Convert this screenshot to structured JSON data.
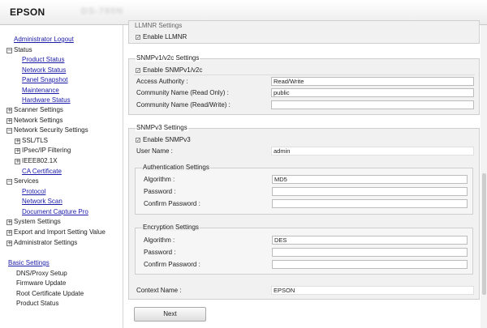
{
  "header": {
    "brand": "EPSON",
    "model": "DS-780N"
  },
  "sidebar": {
    "admin_logout": "Administrator Logout",
    "status": "Status",
    "product_status": "Product Status",
    "network_status": "Network Status",
    "panel_snapshot": "Panel Snapshot",
    "maintenance": "Maintenance",
    "hardware_status": "Hardware Status",
    "scanner_settings": "Scanner Settings",
    "network_settings": "Network Settings",
    "network_security_settings": "Network Security Settings",
    "ssl_tls": "SSL/TLS",
    "ipsec_ip_filtering": "IPsec/IP Filtering",
    "ieee8021x": "IEEE802.1X",
    "ca_certificate": "CA Certificate",
    "services": "Services",
    "protocol": "Protocol",
    "network_scan": "Network Scan",
    "document_capture_pro": "Document Capture Pro",
    "system_settings": "System Settings",
    "export_import": "Export and Import Setting Value",
    "administrator_settings": "Administrator Settings",
    "basic_settings": "Basic Settings",
    "dns_proxy": "DNS/Proxy Setup",
    "firmware_update": "Firmware Update",
    "root_cert_update": "Root Certificate Update",
    "product_status_2": "Product Status"
  },
  "main": {
    "llmnr": {
      "legend": "LLMNR Settings",
      "enable_label": "Enable LLMNR"
    },
    "snmpv1": {
      "legend": "SNMPv1/v2c Settings",
      "enable_label": "Enable SNMPv1/v2c",
      "access_label": "Access Authority :",
      "access_value": "Read/Write",
      "ro_label": "Community Name (Read Only) :",
      "ro_value": "public",
      "rw_label": "Community Name (Read/Write) :",
      "rw_value": ""
    },
    "snmpv3": {
      "legend": "SNMPv3 Settings",
      "enable_label": "Enable SNMPv3",
      "user_label": "User Name :",
      "user_value": "admin",
      "auth": {
        "legend": "Authentication Settings",
        "algo_label": "Algorithm :",
        "algo_value": "MD5",
        "pw_label": "Password :",
        "cpw_label": "Confirm Password :"
      },
      "enc": {
        "legend": "Encryption Settings",
        "algo_label": "Algorithm :",
        "algo_value": "DES",
        "pw_label": "Password :",
        "cpw_label": "Confirm Password :"
      },
      "context_label": "Context Name :",
      "context_value": "EPSON"
    },
    "next_button": "Next"
  }
}
